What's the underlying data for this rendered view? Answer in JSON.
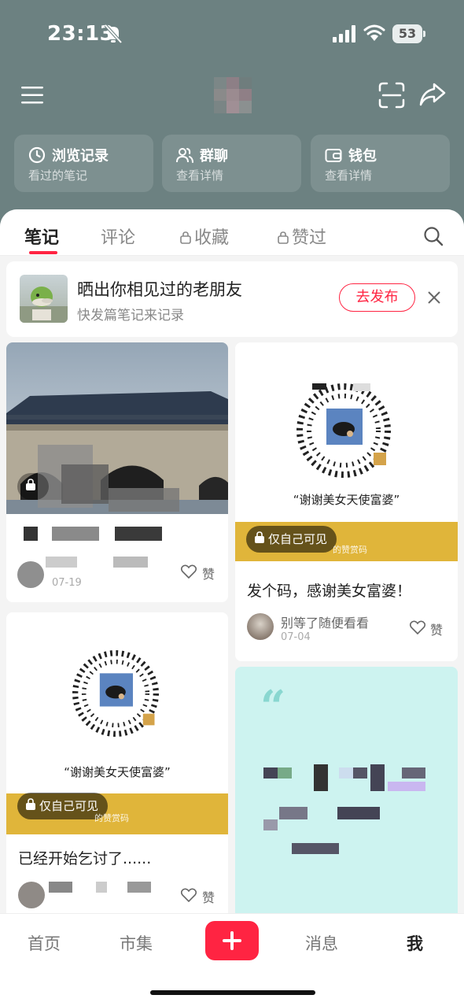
{
  "status_bar": {
    "time": "23:13",
    "battery": "53",
    "icons": [
      "bell-muted-icon",
      "signal-icon",
      "wifi-icon",
      "battery-icon"
    ]
  },
  "header": {
    "icons": [
      "menu-icon",
      "scan-icon",
      "share-icon"
    ],
    "background_color": "#6c8181",
    "quick_cards": [
      {
        "title": "浏览记录",
        "subtitle": "看过的笔记",
        "icon": "clock-icon"
      },
      {
        "title": "群聊",
        "subtitle": "查看详情",
        "icon": "group-icon"
      },
      {
        "title": "钱包",
        "subtitle": "查看详情",
        "icon": "wallet-icon"
      }
    ]
  },
  "tabs": {
    "items": [
      "笔记",
      "评论",
      "收藏",
      "赞过"
    ],
    "active": "笔记",
    "accent_color": "#ff2442"
  },
  "banner": {
    "title": "晒出你相见过的老朋友",
    "subtitle": "快发篇笔记来记录",
    "button": "去发布"
  },
  "posts": {
    "card1": {
      "date": "07-19",
      "like": "赞"
    },
    "card2": {
      "qr_caption": "“谢谢美女天使富婆”",
      "badge": "仅自己可见",
      "code_label": "的赞赏码",
      "title": "发个码，感谢美女富婆！",
      "author": "别等了随便看看",
      "date": "07-04",
      "like": "赞"
    },
    "card3": {
      "qr_caption": "“谢谢美女天使富婆”",
      "badge": "仅自己可见",
      "code_label": "的赞赏码",
      "title": "已经开始乞讨了......",
      "like": "赞"
    },
    "card4": {
      "quote_mark": "“"
    }
  },
  "bottom_nav": {
    "items": [
      "首页",
      "市集",
      "消息",
      "我"
    ],
    "active": "我"
  }
}
